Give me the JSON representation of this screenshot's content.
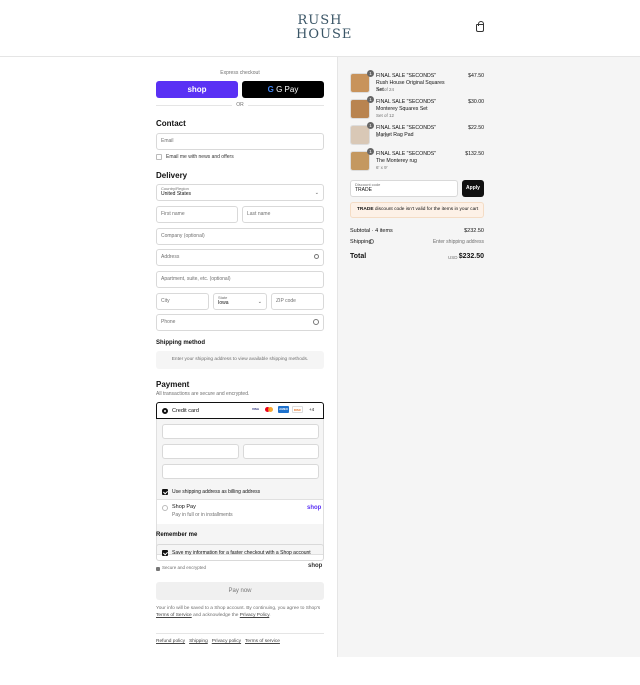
{
  "store": {
    "logo_line1": "RUSH",
    "logo_line2": "HOUSE"
  },
  "express": {
    "label": "Express checkout",
    "shop_label": "shop",
    "gpay_label": "G Pay",
    "or_label": "OR"
  },
  "contact": {
    "title": "Contact",
    "email_placeholder": "Email",
    "news_label": "Email me with news and offers"
  },
  "delivery": {
    "title": "Delivery",
    "country_label": "Country/Region",
    "country_value": "United States",
    "first_name": "First name",
    "last_name": "Last name",
    "company": "Company (optional)",
    "address": "Address",
    "apartment": "Apartment, suite, etc. (optional)",
    "city": "City",
    "state_label": "State",
    "state_value": "Iowa",
    "zip": "ZIP code",
    "phone": "Phone"
  },
  "shipping_method": {
    "title": "Shipping method",
    "message": "Enter your shipping address to view available shipping methods."
  },
  "payment": {
    "title": "Payment",
    "subtitle": "All transactions are secure and encrypted.",
    "credit_card_label": "Credit card",
    "more_cards": "+4",
    "cards": [
      "VISA",
      "MC",
      "AMEX",
      "DISC"
    ],
    "billing_label": "Use shipping address as billing address",
    "shoppay_label": "Shop Pay",
    "shoppay_sub": "Pay in full or in installments",
    "shoppay_logo": "shop"
  },
  "remember": {
    "title": "Remember me",
    "save_label": "Save my information for a faster checkout with a Shop account",
    "secure_label": "Secure and encrypted",
    "shop_logo": "shop"
  },
  "pay_button": "Pay now",
  "legal": {
    "text1": "Your info will be saved to a Shop account. By continuing, you agree to Shop's",
    "terms": "Terms of Service",
    "text2": "and acknowledge the",
    "privacy": "Privacy Policy",
    "end": "."
  },
  "footer_links": [
    "Refund policy",
    "Shipping",
    "Privacy policy",
    "Terms of service"
  ],
  "items": [
    {
      "qty": "1",
      "name": "FINAL SALE \"SECONDS\" Rush House Original Squares Set",
      "variant": "Set of 24",
      "price": "$47.50",
      "thumb_color": "#c8935b"
    },
    {
      "qty": "1",
      "name": "FINAL SALE \"SECONDS\" Monterey Squares Set",
      "variant": "Set of 12",
      "price": "$30.00",
      "thumb_color": "#b98450"
    },
    {
      "qty": "1",
      "name": "FINAL SALE \"SECONDS\" Market Rag Pad",
      "variant": "3' x 12'",
      "price": "$22.50",
      "thumb_color": "#d9c8b6"
    },
    {
      "qty": "1",
      "name": "FINAL SALE \"SECONDS\" The Monterey rug",
      "variant": "6' x 9'",
      "price": "$132.50",
      "thumb_color": "#c49860"
    }
  ],
  "discount": {
    "label": "Discount code",
    "value": "TRADE",
    "apply": "Apply",
    "error_code": "TRADE",
    "error_text": "discount code isn't valid for the items in your cart"
  },
  "totals": {
    "subtotal_label": "Subtotal · 4 items",
    "subtotal": "$232.50",
    "shipping_label": "Shipping",
    "shipping_value": "Enter shipping address",
    "total_label": "Total",
    "currency": "USD",
    "total": "$232.50"
  }
}
